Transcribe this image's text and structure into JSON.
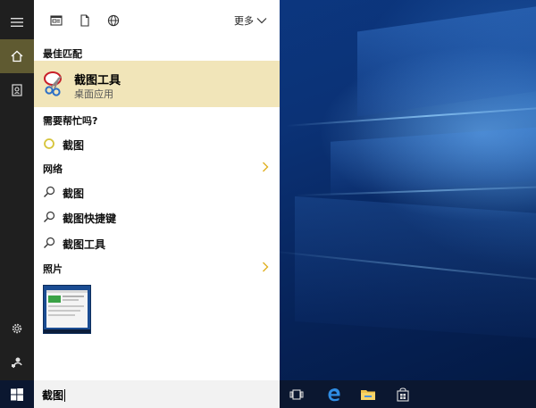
{
  "toolbar": {
    "more_label": "更多",
    "icons": [
      "document-icon",
      "file-icon",
      "globe-icon"
    ]
  },
  "sections": {
    "best_match_header": "最佳匹配",
    "need_help_header": "需要帮忙吗?",
    "web_header": "网络",
    "photos_header": "照片"
  },
  "best_match": {
    "title": "截图工具",
    "subtitle": "桌面应用",
    "icon": "snipping-tool-icon"
  },
  "help_item": {
    "label": "截图",
    "icon": "cortana-circle-icon"
  },
  "web_items": [
    {
      "label": "截图",
      "icon": "search-icon"
    },
    {
      "label": "截图快捷键",
      "icon": "search-icon"
    },
    {
      "label": "截图工具",
      "icon": "search-icon"
    }
  ],
  "search": {
    "query": "截图"
  },
  "rail": {
    "icons": [
      "hamburger-menu-icon",
      "home-icon",
      "notebook-icon",
      "settings-gear-icon",
      "feedback-icon"
    ]
  },
  "taskbar": {
    "icons": [
      "windows-start-icon",
      "task-view-icon",
      "edge-browser-icon",
      "file-explorer-icon",
      "store-icon"
    ]
  },
  "colors": {
    "accent": "#5f5a31",
    "highlight": "#f1e5b9",
    "cortana_ring": "#d6c43a",
    "chevron": "#e0b020",
    "rail_bg": "#1f1f1f",
    "taskbar_bg": "#0b1730"
  }
}
